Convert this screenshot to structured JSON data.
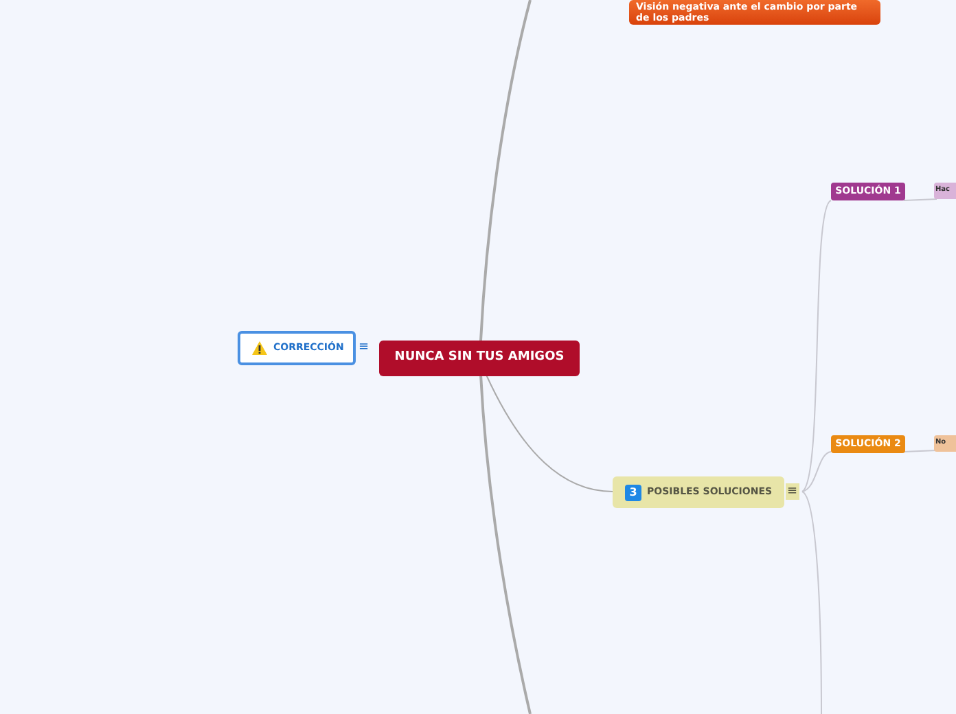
{
  "central_topic": {
    "title": "NUNCA SIN TUS AMIGOS"
  },
  "correction_node": {
    "title": "CORRECCIÓN",
    "notes_icon": "≡"
  },
  "top_node": {
    "title": "Visión negativa ante el cambio por parte de los padres"
  },
  "solutions_node": {
    "number": "3",
    "title": "POSIBLES SOLUCIONES",
    "notes_icon": "≡"
  },
  "subtopics": [
    {
      "title": "SOLUCIÓN 1",
      "color": "#a0398f",
      "child": {
        "title": "Hac",
        "color": "#d9b3d9"
      }
    },
    {
      "title": "SOLUCIÓN 2",
      "color": "#ea8a12",
      "child": {
        "title": "No",
        "color": "#efc29a"
      }
    }
  ]
}
